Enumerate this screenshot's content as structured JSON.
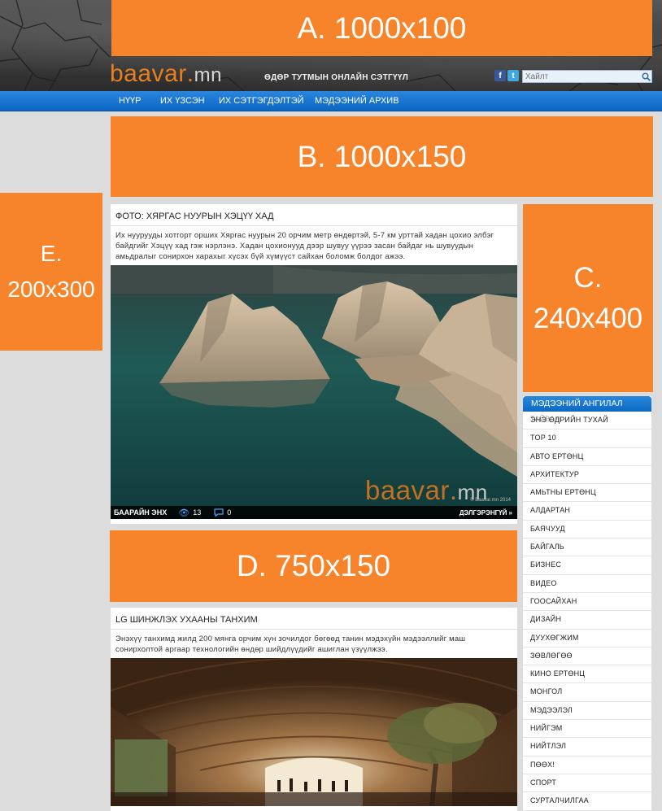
{
  "ads": {
    "a": "A. 1000x100",
    "b": "B. 1000x150",
    "c_line1": "C.",
    "c_line2": "240x400",
    "d": "D. 750x150",
    "e_line1": "E.",
    "e_line2": "200x300"
  },
  "header": {
    "logo_main": "baavar",
    "logo_dot": ".",
    "logo_tld": "mn",
    "tagline": "ӨДӨР ТУТМЫН ОНЛАЙН СЭТГҮҮЛ",
    "social": [
      "f",
      "t"
    ],
    "search_placeholder": "Хайлт",
    "search_icon": "search-icon"
  },
  "nav": [
    "НҮҮР",
    "ИХ ҮЗСЭН",
    "ИХ СЭТГЭГДЭЛТЭЙ",
    "МЭДЭЭНИЙ АРХИВ"
  ],
  "articles": [
    {
      "title": "ФОТО: ХЯРГАС НУУРЫН ХЭЦҮҮ ХАД",
      "desc": "Их нуурууды хотгорт орших Хяргас нуурын 20 орчим метр өндөртэй, 5-7 км урттай хадан цохио элбэг байдгийг Хэцүү хад гэж нэрлэнэ. Хадан цохионууд дээр шувуу үүрээ засан байдаг нь шувуудын амьдралыг сонирхон харахыг хүсэх бүй хүмүүст сайхан боломж болдог ажээ.",
      "photo_logo_main": "baavar",
      "photo_logo_dot": ".",
      "photo_logo_tld": "mn",
      "source": "БААРАЙН ЭНХ",
      "views": "13",
      "comments": "0",
      "more": "ДЭЛГЭРЭНГҮЙ »",
      "copyright": "© Baavar.mn 2014"
    },
    {
      "title": "LG ШИНЖЛЭХ УХААНЫ ТАНХИМ",
      "desc": "Энэхүү танхимд жилд 200 мянга орчим хүн зочилдог бөгөөд танин мэдэхүйн мэдээллийг маш сонирхолтой аргаар технологийн өндөр шийдлүүдийг ашиглан үзүүлжээ."
    }
  ],
  "categories": {
    "header": "МЭДЭЭНИЙ АНГИЛАЛ",
    "first_overlap": "ТАЙВАН",
    "items": [
      "ЭНЭ ӨДРИЙН ТУХАЙ",
      "TOP 10",
      "АВТО ЕРТӨНЦ",
      "АРХИТЕКТУР",
      "АМЬТНЫ ЕРТӨНЦ",
      "АЛДАРТАН",
      "БАЯЧУУД",
      "БАЙГАЛЬ",
      "БИЗНЕС",
      "ВИДЕО",
      "ГООСАЙХАН",
      "ДИЗАЙН",
      "ДУУХӨГЖИМ",
      "ЗӨВЛӨГӨӨ",
      "КИНО ЕРТӨНЦ",
      "МОНГОЛ",
      "МЭДЭЭЛЭЛ",
      "НИЙГЭМ",
      "НИЙТЛЭЛ",
      "ПӨӨХ!",
      "СПОРТ",
      "СУРТАЛЧИЛГАА"
    ]
  },
  "colors": {
    "ad_orange": "#f7842b",
    "nav_blue": "#0a66c2",
    "logo_orange": "#e6801f",
    "page_bg": "#dcdcdc"
  }
}
